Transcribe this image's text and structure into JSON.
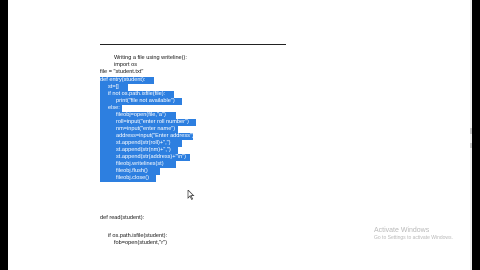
{
  "document": {
    "lines": [
      {
        "text": "Writing a file using writeline():",
        "indent": 0,
        "selected": false
      },
      {
        "text": "import os",
        "indent": 0,
        "selected": false
      },
      {
        "text": "file = \"student.txt\"",
        "indent": 0,
        "selected": false
      },
      {
        "text": "def entry(student):",
        "indent": 0,
        "selected": true
      },
      {
        "text": "st=[]",
        "indent": 1,
        "selected": true
      },
      {
        "text": "if not os.path.isfile(file):",
        "indent": 1,
        "selected": true
      },
      {
        "text": "print(\"file not available\")",
        "indent": 2,
        "selected": true
      },
      {
        "text": "else:",
        "indent": 1,
        "selected": true
      },
      {
        "text": "fileobj=open(file,\"a\")",
        "indent": 2,
        "selected": true
      },
      {
        "text": "roll=input(\"enter roll number\")",
        "indent": 2,
        "selected": true
      },
      {
        "text": "nm=input(\"enter name\")",
        "indent": 2,
        "selected": true
      },
      {
        "text": "address=input(\"Enter address\")",
        "indent": 2,
        "selected": true
      },
      {
        "text": "st.append(str(roll)+\",\")",
        "indent": 2,
        "selected": true
      },
      {
        "text": "st.append(str(nm)+\",\")",
        "indent": 2,
        "selected": true
      },
      {
        "text": "st.append(str(address)+\"\\n\")",
        "indent": 2,
        "selected": true
      },
      {
        "text": "fileobj.writelines(st)",
        "indent": 2,
        "selected": true
      },
      {
        "text": "fileobj.flush()",
        "indent": 2,
        "selected": true
      },
      {
        "text": "fileobj.close()",
        "indent": 2,
        "selected": true
      },
      {
        "text": "def read(student):",
        "indent": 0,
        "selected": false
      },
      {
        "text": "if os.path.isfile(student):",
        "indent": 1,
        "selected": false
      },
      {
        "text": "fob=open(student,\"r\")",
        "indent": 2,
        "selected": false
      }
    ]
  },
  "watermark": {
    "title": "Activate Windows",
    "subtitle": "Go to Settings to activate Windows."
  }
}
